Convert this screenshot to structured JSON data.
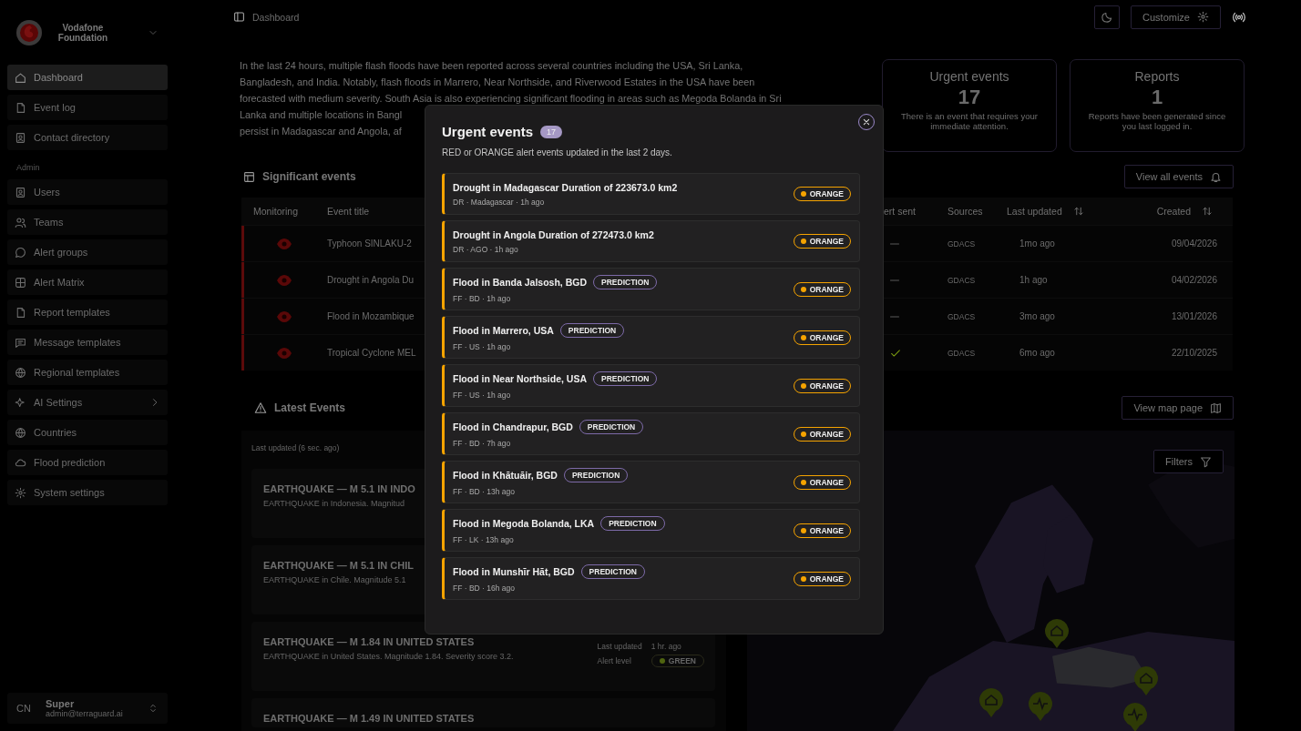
{
  "sidebar": {
    "org": "Vodafone Foundation",
    "main_items": [
      {
        "label": "Dashboard",
        "selected": true,
        "submenu": false
      },
      {
        "label": "Event log",
        "selected": false,
        "submenu": false
      },
      {
        "label": "Contact directory",
        "selected": false,
        "submenu": false
      }
    ],
    "section_label": "Admin",
    "admin_items": [
      {
        "label": "Users",
        "selected": false,
        "submenu": false
      },
      {
        "label": "Teams",
        "selected": false,
        "submenu": false
      },
      {
        "label": "Alert groups",
        "selected": false,
        "submenu": false
      },
      {
        "label": "Alert Matrix",
        "selected": false,
        "submenu": false
      },
      {
        "label": "Report templates",
        "selected": false,
        "submenu": false
      },
      {
        "label": "Message templates",
        "selected": false,
        "submenu": false
      },
      {
        "label": "Regional templates",
        "selected": false,
        "submenu": false
      },
      {
        "label": "AI Settings",
        "selected": false,
        "submenu": true
      },
      {
        "label": "Countries",
        "selected": false,
        "submenu": false
      },
      {
        "label": "Flood prediction",
        "selected": false,
        "submenu": false
      },
      {
        "label": "System settings",
        "selected": false,
        "submenu": false
      }
    ],
    "user": {
      "initials": "CN",
      "name": "Super",
      "email": "admin@terraguard.ai"
    }
  },
  "header": {
    "breadcrumb": "Dashboard",
    "customize": "Customize"
  },
  "summary_lines": [
    "In the last 24 hours, multiple flash floods have been reported across several countries including the USA, Sri Lanka,",
    "Bangladesh, and India. Notably, flash floods in Marrero, Near Northside, and Riverwood Estates in the USA have been",
    "forecasted with medium severity. South Asia is also experiencing significant flooding in areas such as Megoda Bolanda in Sri",
    "Lanka and multiple locations in Bangl",
    "persist in Madagascar and Angola, af"
  ],
  "stats": [
    {
      "title": "Urgent events",
      "value": "17",
      "text": "There is an event that requires your immediate attention."
    },
    {
      "title": "Reports",
      "value": "1",
      "text": "Reports have been generated since you last logged in."
    }
  ],
  "significant": {
    "title": "Significant events",
    "button": "View all events",
    "columns": [
      {
        "label": "Monitoring",
        "sortable": false
      },
      {
        "label": "Event title",
        "sortable": false
      },
      {
        "label": "ert sent",
        "sortable": false
      },
      {
        "label": "Sources",
        "sortable": false
      },
      {
        "label": "Last updated",
        "sortable": true
      },
      {
        "label": "Created",
        "sortable": true
      }
    ],
    "rows": [
      {
        "title": "Typhoon SINLAKU-2",
        "color": "#5c0a0a",
        "sent": false,
        "source": "GDACS",
        "updated": "1mo ago",
        "created": "09/04/2026"
      },
      {
        "title": "Drought in Angola Du",
        "color": "#5c0a0a",
        "sent": false,
        "source": "GDACS",
        "updated": "1h ago",
        "created": "04/02/2026"
      },
      {
        "title": "Flood in Mozambique",
        "color": "#5c0a0a",
        "sent": false,
        "source": "GDACS",
        "updated": "3mo ago",
        "created": "13/01/2026"
      },
      {
        "title": "Tropical Cyclone MEL",
        "color": "#5c0a0a",
        "sent": true,
        "source": "GDACS",
        "updated": "6mo ago",
        "created": "22/10/2025"
      }
    ]
  },
  "latest": {
    "title": "Latest Events",
    "button": "View map page",
    "updated": "Last updated (6 sec. ago)",
    "filters": "Filters",
    "cards": [
      {
        "title": "EARTHQUAKE — M 5.1 IN INDO",
        "description": "EARTHQUAKE in Indonesia. Magnitud"
      },
      {
        "title": "EARTHQUAKE — M 5.1 IN CHIL",
        "description": "EARTHQUAKE in Chile. Magnitude 5.1"
      },
      {
        "title": "EARTHQUAKE — M 1.84 IN UNITED STATES",
        "description": "EARTHQUAKE in United States. Magnitude 1.84. Severity score 3.2.",
        "updated_label": "Last updated",
        "updated": "1 hr. ago",
        "level_label": "Alert level",
        "level": "GREEN",
        "color": "#4f6410"
      },
      {
        "title": "EARTHQUAKE — M 1.49 IN UNITED STATES"
      }
    ]
  },
  "modal": {
    "title": "Urgent events",
    "count": "17",
    "subtitle": "RED or ORANGE alert events updated in the last 2 days.",
    "items": [
      {
        "title": "Drought in Madagascar Duration of 223673.0 km2",
        "meta": "DR · Madagascar · 1h ago",
        "level": "ORANGE",
        "color": "#f5a300"
      },
      {
        "title": "Drought in Angola Duration of 272473.0 km2",
        "meta": "DR · AGO · 1h ago",
        "level": "ORANGE",
        "color": "#f5a300"
      },
      {
        "title": "Flood in Banda Jalsosh, BGD",
        "tag": "PREDICTION",
        "meta": "FF · BD · 1h ago",
        "level": "ORANGE",
        "color": "#f5a300"
      },
      {
        "title": "Flood in Marrero, USA",
        "tag": "PREDICTION",
        "meta": "FF · US · 1h ago",
        "level": "ORANGE",
        "color": "#f5a300"
      },
      {
        "title": "Flood in Near Northside, USA",
        "tag": "PREDICTION",
        "meta": "FF · US · 1h ago",
        "level": "ORANGE",
        "color": "#f5a300"
      },
      {
        "title": "Flood in Chandrapur, BGD",
        "tag": "PREDICTION",
        "meta": "FF · BD · 7h ago",
        "level": "ORANGE",
        "color": "#f5a300"
      },
      {
        "title": "Flood in Khātuāir, BGD",
        "tag": "PREDICTION",
        "meta": "FF · BD · 13h ago",
        "level": "ORANGE",
        "color": "#f5a300"
      },
      {
        "title": "Flood in Megoda Bolanda, LKA",
        "tag": "PREDICTION",
        "meta": "FF · LK · 13h ago",
        "level": "ORANGE",
        "color": "#f5a300"
      },
      {
        "title": "Flood in Munshīr Hāt, BGD",
        "tag": "PREDICTION",
        "meta": "FF · BD · 16h ago",
        "level": "ORANGE",
        "color": "#f5a300"
      }
    ]
  }
}
